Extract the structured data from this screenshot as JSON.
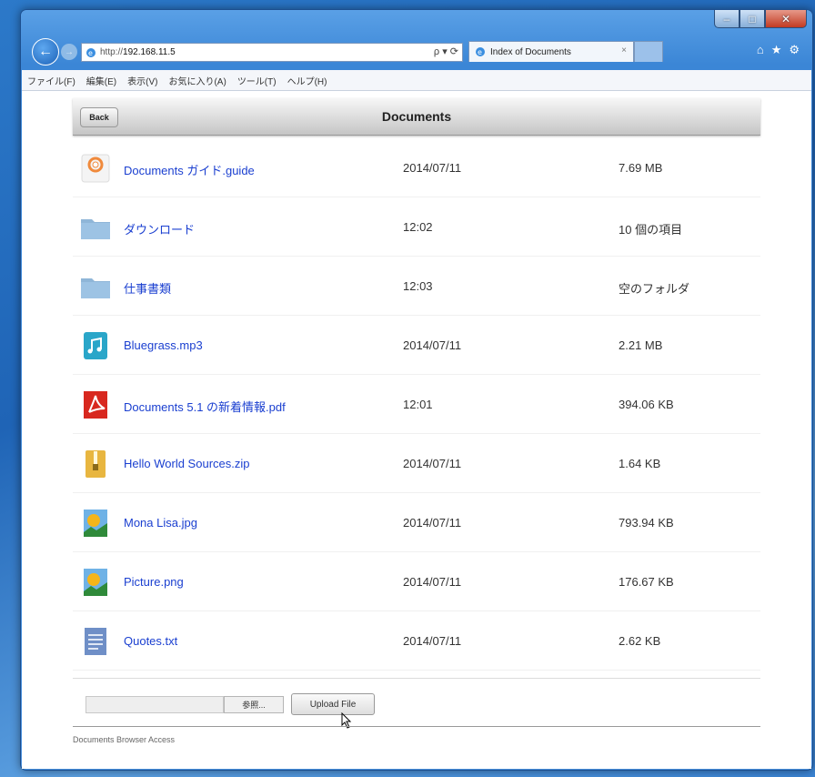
{
  "browser": {
    "url_prefix": "http://",
    "url_host": "192.168.11.5",
    "url_tools": "ρ ▾ ⟳",
    "tab_title": "Index of Documents",
    "tab_close": "×",
    "caption": {
      "minimize": "–",
      "maximize": "□",
      "close": "✕"
    },
    "right_icons": {
      "home": "⌂",
      "favorites": "★",
      "tools": "⚙"
    }
  },
  "menu": [
    "ファイル(F)",
    "編集(E)",
    "表示(V)",
    "お気に入り(A)",
    "ツール(T)",
    "ヘルプ(H)"
  ],
  "header": {
    "back_label": "Back",
    "title": "Documents"
  },
  "files": [
    {
      "name": "Documents ガイド.guide",
      "date": "2014/07/11",
      "size": "7.69 MB",
      "icon": "guide-icon"
    },
    {
      "name": "ダウンロード",
      "date": "12:02",
      "size": "10 個の項目",
      "icon": "folder-icon"
    },
    {
      "name": "仕事書類",
      "date": "12:03",
      "size": "空のフォルダ",
      "icon": "folder-icon"
    },
    {
      "name": "Bluegrass.mp3",
      "date": "2014/07/11",
      "size": "2.21 MB",
      "icon": "music-icon"
    },
    {
      "name": "Documents 5.1 の新着情報.pdf",
      "date": "12:01",
      "size": "394.06 KB",
      "icon": "pdf-icon"
    },
    {
      "name": "Hello World Sources.zip",
      "date": "2014/07/11",
      "size": "1.64 KB",
      "icon": "zip-icon"
    },
    {
      "name": "Mona Lisa.jpg",
      "date": "2014/07/11",
      "size": "793.94 KB",
      "icon": "image-icon"
    },
    {
      "name": "Picture.png",
      "date": "2014/07/11",
      "size": "176.67 KB",
      "icon": "image-icon"
    },
    {
      "name": "Quotes.txt",
      "date": "2014/07/11",
      "size": "2.62 KB",
      "icon": "text-icon"
    }
  ],
  "upload": {
    "browse_label": "参照...",
    "upload_label": "Upload File"
  },
  "footer": {
    "text": "Documents Browser Access"
  }
}
